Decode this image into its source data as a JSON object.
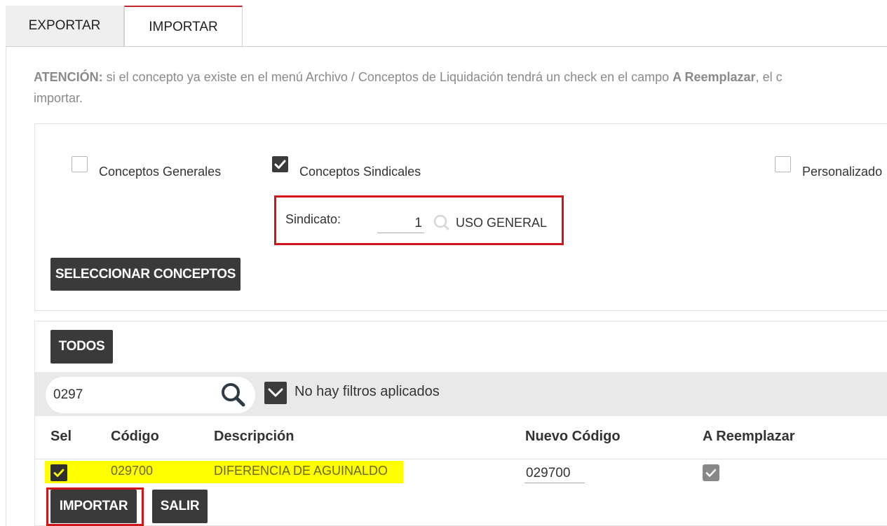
{
  "tabs": [
    {
      "label": "EXPORTAR",
      "active": false
    },
    {
      "label": "IMPORTAR",
      "active": true
    }
  ],
  "notice": {
    "bold_prefix": "ATENCIÓN:",
    "text_a": " si el concepto ya existe en el menú Archivo / Conceptos de Liquidación tendrá un check en el campo ",
    "bold_field": "A Reemplazar",
    "text_b": ", el c",
    "line2": "importar."
  },
  "options": {
    "generales": {
      "label": "Conceptos Generales",
      "checked": false
    },
    "sindicales": {
      "label": "Conceptos Sindicales",
      "checked": true
    },
    "personalizados": {
      "label": "Personalizado",
      "checked": false
    }
  },
  "sindicato": {
    "label": "Sindicato:",
    "value": "1",
    "description": "USO GENERAL"
  },
  "buttons": {
    "seleccionar": "SELECCIONAR CONCEPTOS",
    "todos": "TODOS",
    "importar": "IMPORTAR",
    "salir": "SALIR"
  },
  "filter": {
    "search_value": "0297",
    "status_text": "No hay filtros aplicados"
  },
  "table": {
    "columns": [
      "Sel",
      "Código",
      "Descripción",
      "Nuevo Código",
      "A Reemplazar"
    ],
    "rows": [
      {
        "sel": true,
        "codigo": "029700",
        "descripcion": "DIFERENCIA DE AGUINALDO",
        "nuevo_codigo": "029700",
        "a_reemplazar": true
      }
    ]
  },
  "colors": {
    "accent_red": "#d0141c",
    "button_dark": "#3a3a3a",
    "highlight_yellow": "#ffff00"
  }
}
